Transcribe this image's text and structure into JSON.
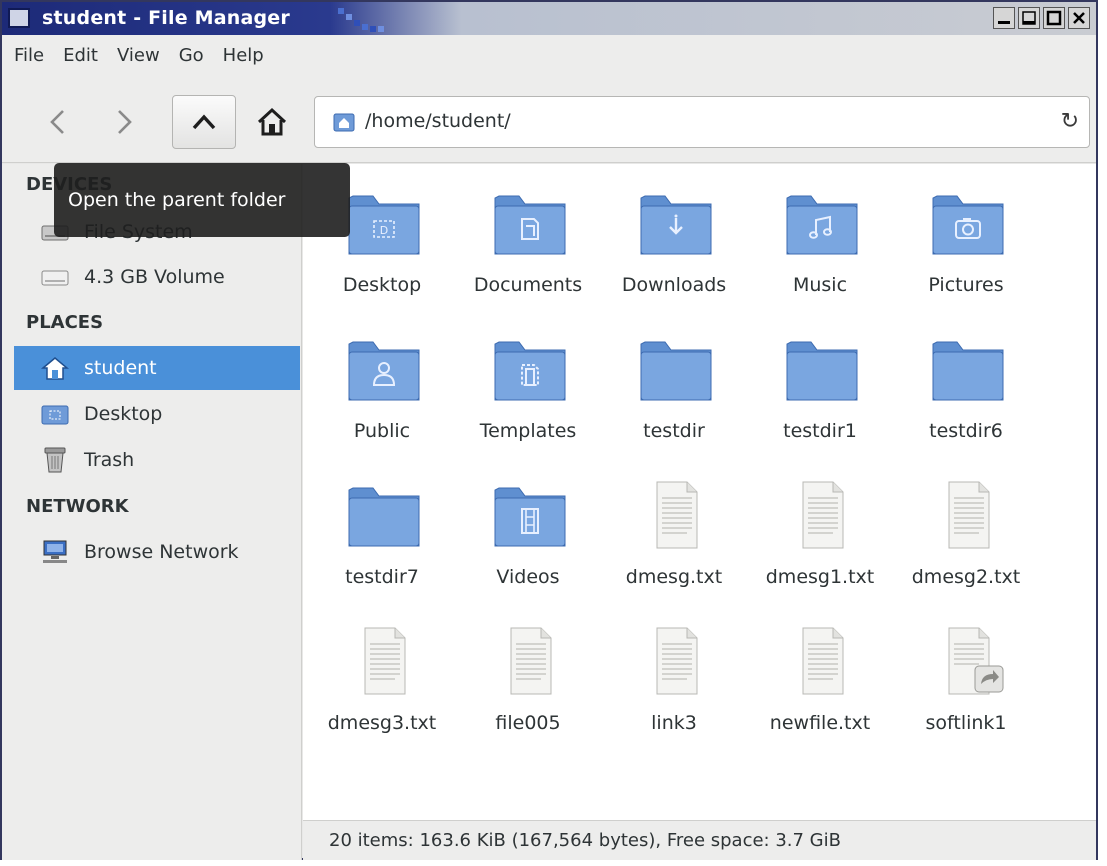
{
  "window": {
    "title": "student - File Manager",
    "controls": [
      "minimize",
      "maximize",
      "restore",
      "close"
    ]
  },
  "menubar": {
    "items": [
      "File",
      "Edit",
      "View",
      "Go",
      "Help"
    ]
  },
  "toolbar": {
    "back_icon": "chevron-left-icon",
    "forward_icon": "chevron-right-icon",
    "up_icon": "chevron-up-icon",
    "home_icon": "home-icon",
    "address": "/home/student/",
    "reload_icon": "reload-icon"
  },
  "tooltip": {
    "text": "Open the parent folder"
  },
  "sidebar": {
    "sections": [
      {
        "heading": "DEVICES",
        "items": [
          {
            "label": "File System",
            "icon": "drive-icon"
          },
          {
            "label": "4.3 GB Volume",
            "icon": "drive-icon"
          }
        ]
      },
      {
        "heading": "PLACES",
        "items": [
          {
            "label": "student",
            "icon": "home-icon",
            "selected": true
          },
          {
            "label": "Desktop",
            "icon": "desktop-folder-icon"
          },
          {
            "label": "Trash",
            "icon": "trash-icon"
          }
        ]
      },
      {
        "heading": "NETWORK",
        "items": [
          {
            "label": "Browse Network",
            "icon": "network-icon"
          }
        ]
      }
    ]
  },
  "files": [
    {
      "name": "Desktop",
      "icon": "desktop-folder-icon"
    },
    {
      "name": "Documents",
      "icon": "documents-folder-icon"
    },
    {
      "name": "Downloads",
      "icon": "downloads-folder-icon"
    },
    {
      "name": "Music",
      "icon": "music-folder-icon"
    },
    {
      "name": "Pictures",
      "icon": "pictures-folder-icon"
    },
    {
      "name": "Public",
      "icon": "public-folder-icon"
    },
    {
      "name": "Templates",
      "icon": "templates-folder-icon"
    },
    {
      "name": "testdir",
      "icon": "folder-icon"
    },
    {
      "name": "testdir1",
      "icon": "folder-icon"
    },
    {
      "name": "testdir6",
      "icon": "folder-icon"
    },
    {
      "name": "testdir7",
      "icon": "folder-icon"
    },
    {
      "name": "Videos",
      "icon": "videos-folder-icon"
    },
    {
      "name": "dmesg.txt",
      "icon": "text-file-icon"
    },
    {
      "name": "dmesg1.txt",
      "icon": "text-file-icon"
    },
    {
      "name": "dmesg2.txt",
      "icon": "text-file-icon"
    },
    {
      "name": "dmesg3.txt",
      "icon": "text-file-icon"
    },
    {
      "name": "file005",
      "icon": "text-file-icon"
    },
    {
      "name": "link3",
      "icon": "text-file-icon"
    },
    {
      "name": "newfile.txt",
      "icon": "text-file-icon"
    },
    {
      "name": "softlink1",
      "icon": "symlink-file-icon"
    }
  ],
  "statusbar": {
    "text": "20 items: 163.6 KiB (167,564 bytes), Free space: 3.7 GiB"
  },
  "colors": {
    "folder": "#6f9bd8",
    "selection": "#4a90d9",
    "title_bar": "#1d2a78"
  }
}
